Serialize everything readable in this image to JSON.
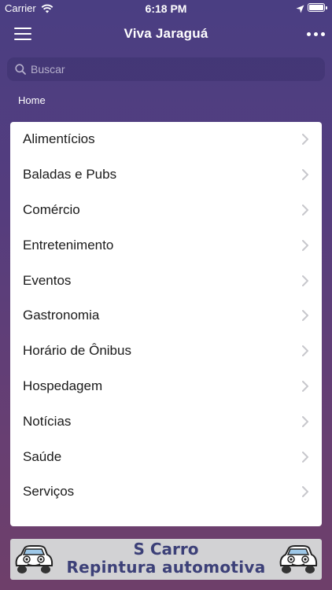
{
  "status_bar": {
    "carrier": "Carrier",
    "time": "6:18 PM"
  },
  "header": {
    "title": "Viva Jaraguá"
  },
  "search": {
    "placeholder": "Buscar"
  },
  "breadcrumb": "Home",
  "categories": [
    {
      "label": "Alimentícios"
    },
    {
      "label": "Baladas e Pubs"
    },
    {
      "label": "Comércio"
    },
    {
      "label": "Entretenimento"
    },
    {
      "label": "Eventos"
    },
    {
      "label": "Gastronomia"
    },
    {
      "label": "Horário de Ônibus"
    },
    {
      "label": "Hospedagem"
    },
    {
      "label": "Notícias"
    },
    {
      "label": "Saúde"
    },
    {
      "label": "Serviços"
    }
  ],
  "banner": {
    "line1": "S Carro",
    "line2": "Repintura automotiva"
  },
  "colors": {
    "background_top": "#4a3e82",
    "background_bottom": "#6e3f6a",
    "card": "#ffffff",
    "banner_text": "#3c4078",
    "chevron": "#c7c7cc"
  }
}
